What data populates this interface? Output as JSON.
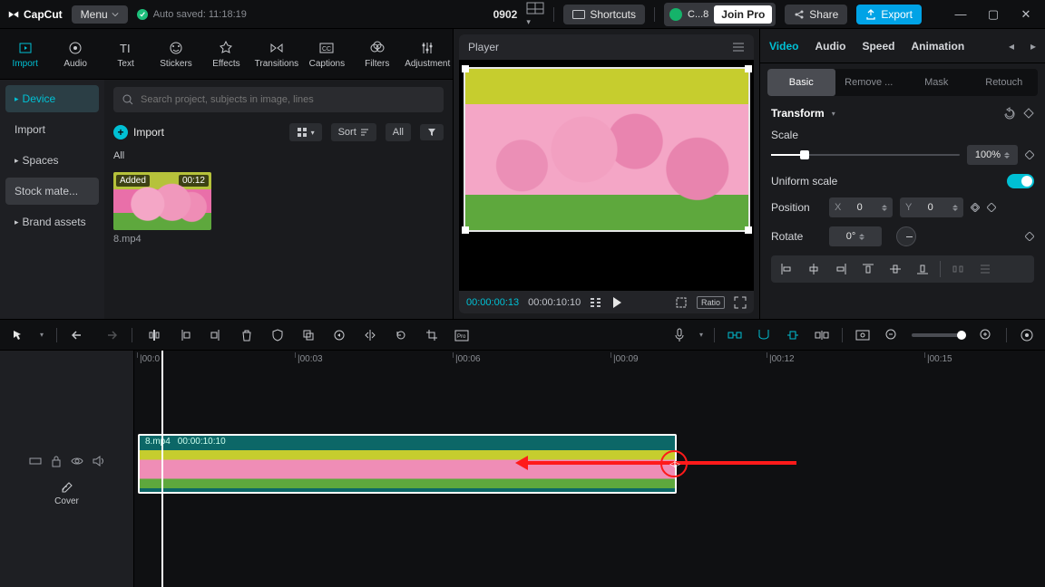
{
  "app": {
    "name": "CapCut",
    "menu": "Menu",
    "autosaved": "Auto saved: 11:18:19",
    "project": "0902",
    "shortcuts": "Shortcuts",
    "user": "C...8",
    "joinpro": "Join Pro",
    "share": "Share",
    "export": "Export"
  },
  "tool_tabs": [
    {
      "label": "Import",
      "active": true
    },
    {
      "label": "Audio"
    },
    {
      "label": "Text"
    },
    {
      "label": "Stickers"
    },
    {
      "label": "Effects"
    },
    {
      "label": "Transitions"
    },
    {
      "label": "Captions"
    },
    {
      "label": "Filters"
    },
    {
      "label": "Adjustment"
    }
  ],
  "library": {
    "sidebar": [
      {
        "label": "Device",
        "active": true,
        "chev": true
      },
      {
        "label": "Import"
      },
      {
        "label": "Spaces",
        "chev": true
      },
      {
        "label": "Stock mate...",
        "pill": true
      },
      {
        "label": "Brand assets",
        "chev": true
      }
    ],
    "search_placeholder": "Search project, subjects in image, lines",
    "import_btn": "Import",
    "sort": "Sort",
    "all_btn": "All",
    "all_label": "All",
    "clips": [
      {
        "name": "8.mp4",
        "added": "Added",
        "dur": "00:12"
      }
    ]
  },
  "player": {
    "title": "Player",
    "tc_current": "00:00:00:13",
    "tc_total": "00:00:10:10",
    "ratio": "Ratio"
  },
  "inspector": {
    "tabs": [
      "Video",
      "Audio",
      "Speed",
      "Animation"
    ],
    "active_tab": 0,
    "subtabs": [
      "Basic",
      "Remove ...",
      "Mask",
      "Retouch"
    ],
    "active_subtab": 0,
    "transform": "Transform",
    "scale": {
      "label": "Scale",
      "value": "100%"
    },
    "uniform": {
      "label": "Uniform scale"
    },
    "position": {
      "label": "Position",
      "x_label": "X",
      "x": "0",
      "y_label": "Y",
      "y": "0"
    },
    "rotate": {
      "label": "Rotate",
      "value": "0°"
    }
  },
  "timeline": {
    "ruler": [
      "|00:0",
      "|00:03",
      "|00:06",
      "|00:09",
      "|00:12",
      "|00:15"
    ],
    "clip": {
      "name": "8.mp4",
      "dur": "00:00:10:10"
    },
    "cover": "Cover"
  }
}
